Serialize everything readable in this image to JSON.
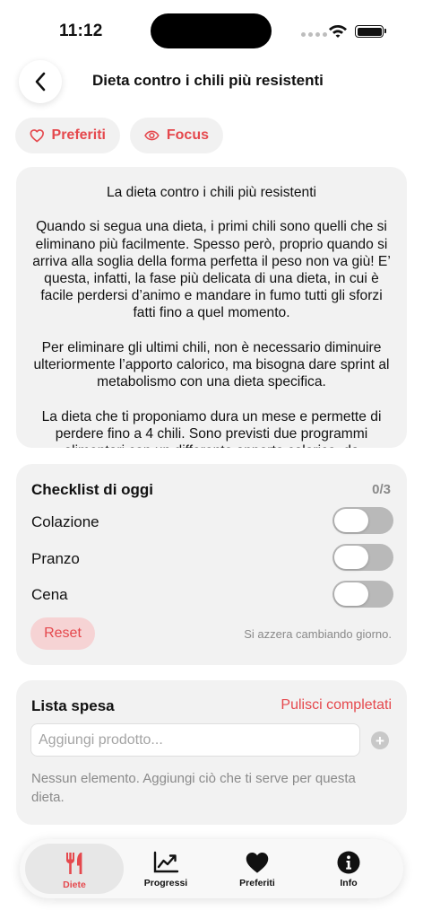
{
  "status_bar": {
    "time": "11:12"
  },
  "header": {
    "title": "Dieta contro i chili più resistenti"
  },
  "chips": {
    "favorites": "Preferiti",
    "focus": "Focus"
  },
  "article": {
    "paragraphs": [
      "La dieta contro i chili più resistenti",
      "Quando si segua una dieta, i primi chili sono quelli che si eliminano più facilmente. Spesso però, proprio quando si arriva alla soglia della forma perfetta il peso non va giù! E’ questa, infatti, la fase più delicata di una dieta, in cui è facile perdersi d’animo e mandare in fumo tutti gli sforzi fatti fino a quel momento.",
      "Per eliminare gli ultimi chili, non è necessario diminuire ulteriormente l’apporto calorico, ma bisogna dare sprint al metabolismo con una dieta specifica.",
      "La dieta che ti proponiamo dura un mese e permette di perdere fino a 4 chili. Sono previsti due programmi alimentari con un differente apporto calorico, da"
    ]
  },
  "checklist": {
    "title": "Checklist di oggi",
    "count": "0/3",
    "items": [
      {
        "label": "Colazione"
      },
      {
        "label": "Pranzo"
      },
      {
        "label": "Cena"
      }
    ],
    "reset_label": "Reset",
    "hint": "Si azzera cambiando giorno."
  },
  "shopping": {
    "title": "Lista spesa",
    "clear_label": "Pulisci completati",
    "placeholder": "Aggiungi prodotto...",
    "empty_text": "Nessun elemento. Aggiungi ciò che ti serve per questa dieta."
  },
  "tabbar": {
    "tabs": [
      {
        "label": "Diete",
        "icon": "fork-knife-icon"
      },
      {
        "label": "Progressi",
        "icon": "chart-icon"
      },
      {
        "label": "Preferiti",
        "icon": "heart-icon"
      },
      {
        "label": "Info",
        "icon": "info-icon"
      }
    ]
  },
  "colors": {
    "accent": "#e5484d",
    "card": "#f2f2f2",
    "toggle_off": "#b9b9b9"
  }
}
